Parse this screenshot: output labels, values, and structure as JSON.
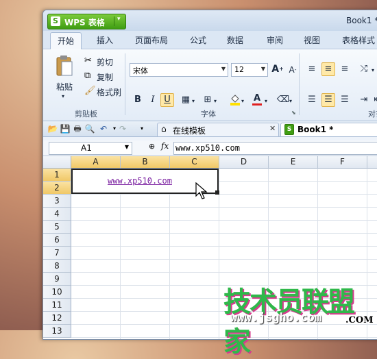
{
  "app": {
    "brand": "WPS 表格",
    "document_title": "Book1 *"
  },
  "ribbon_tabs": [
    "开始",
    "插入",
    "页面布局",
    "公式",
    "数据",
    "审阅",
    "视图",
    "表格样式"
  ],
  "clipboard": {
    "paste": "粘贴",
    "cut": "剪切",
    "copy": "复制",
    "format_painter": "格式刷",
    "group_title": "剪贴板"
  },
  "font": {
    "name": "宋体",
    "size": "12",
    "group_title": "字体",
    "bold": "B",
    "italic": "I",
    "underline": "U",
    "grow": "A",
    "shrink": "A",
    "color_letter": "A"
  },
  "align": {
    "group_title_partial": "对齐"
  },
  "doc_tabs": {
    "templates": "在线模板",
    "book": "Book1 *"
  },
  "formula_bar": {
    "cell_ref": "A1",
    "fx": "fx",
    "value": "www.xp510.com"
  },
  "grid": {
    "columns": [
      "A",
      "B",
      "C",
      "D",
      "E",
      "F"
    ],
    "rows": [
      "1",
      "2",
      "3",
      "4",
      "5",
      "6",
      "7",
      "8",
      "9",
      "10",
      "11",
      "12",
      "13"
    ],
    "merged_cell_text": "www.xp510.com"
  },
  "watermark": {
    "title": "技术员联盟家",
    "url": "www.jsgho.com",
    "suffix": ".COM"
  },
  "colors": {
    "brand_green": "#3f9d12",
    "link_purple": "#7a1fa0",
    "selected_header": "#f0c867",
    "underline_active": "#ffe9a8",
    "font_color_red": "#e02020",
    "highlight_yellow": "#ffe000"
  }
}
